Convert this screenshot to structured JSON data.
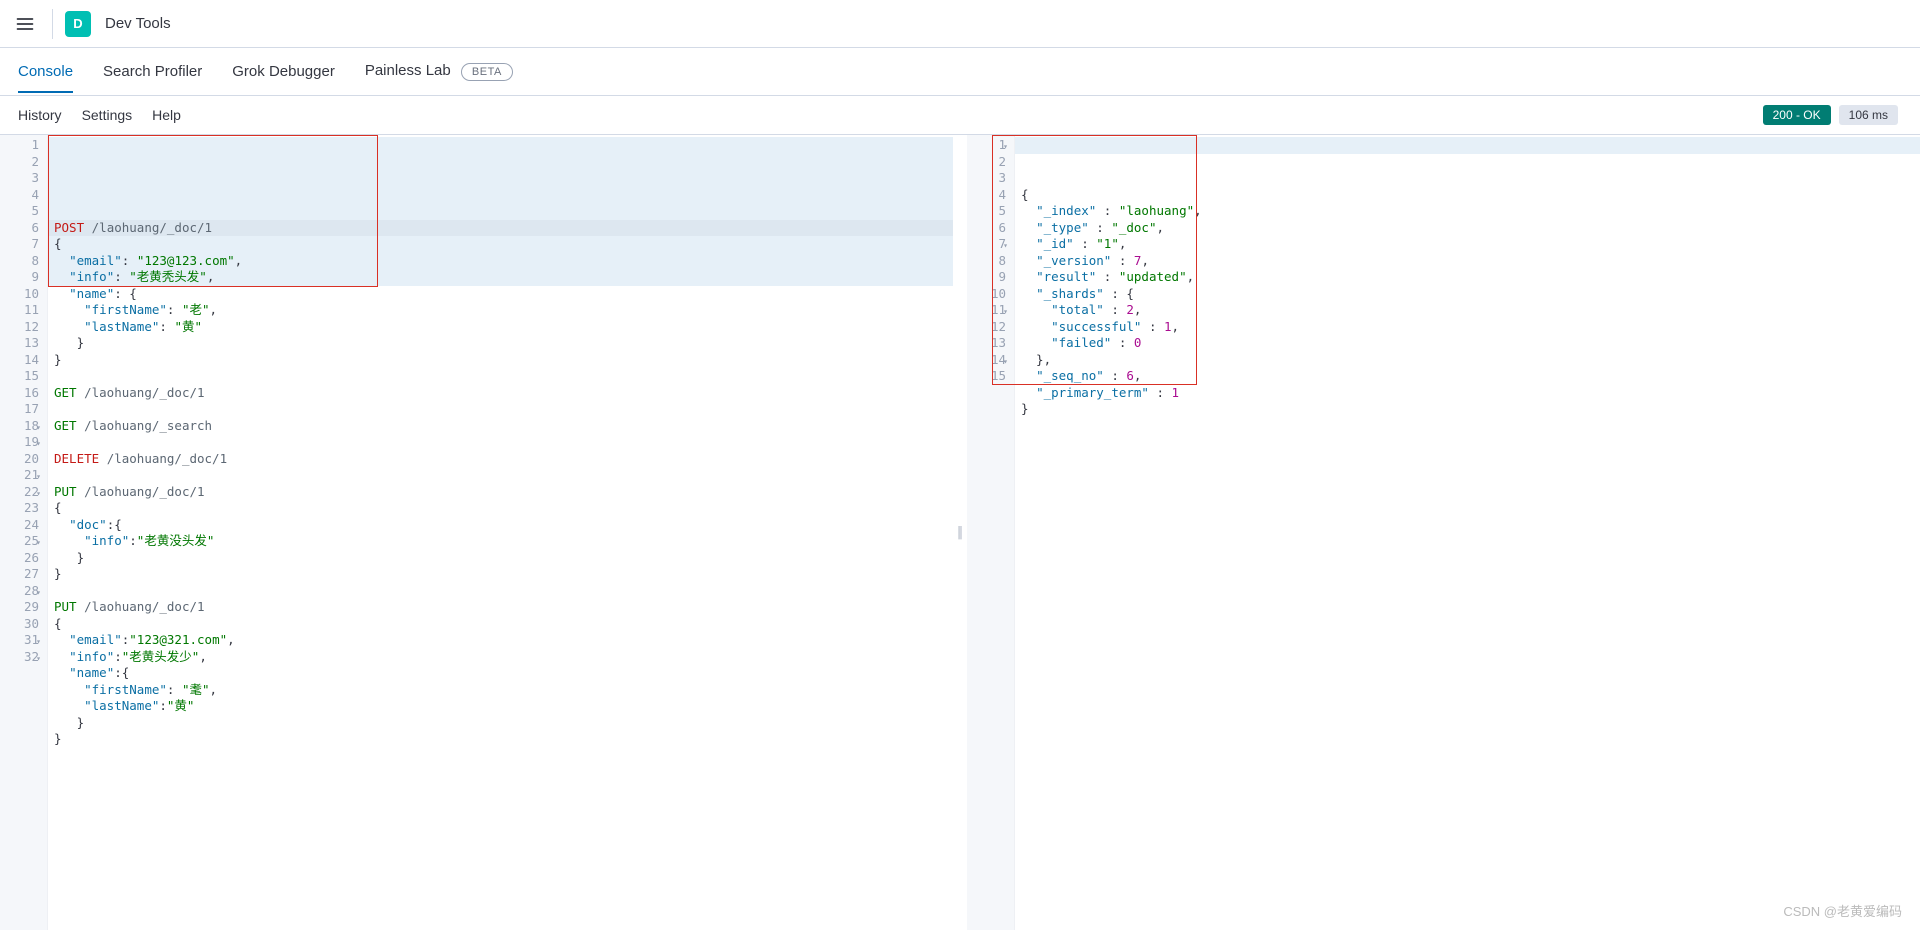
{
  "header": {
    "logo_letter": "D",
    "breadcrumb": "Dev Tools"
  },
  "tabs": {
    "console": "Console",
    "search_profiler": "Search Profiler",
    "grok": "Grok Debugger",
    "painless": "Painless Lab",
    "beta": "BETA"
  },
  "subnav": {
    "history": "History",
    "settings": "Settings",
    "help": "Help"
  },
  "status": {
    "ok": "200 - OK",
    "time": "106 ms"
  },
  "editor_left_lines": [
    {
      "n": "1",
      "method": "POST",
      "url": "/laohuang/_doc/1"
    },
    {
      "n": "2",
      "raw": "{"
    },
    {
      "n": "3",
      "kv": true,
      "ind": "  ",
      "key": "\"email\"",
      "sep": ": ",
      "val": "\"123@123.com\"",
      "tail": ","
    },
    {
      "n": "4",
      "kv": true,
      "ind": "  ",
      "key": "\"info\"",
      "sep": ": ",
      "val": "\"老黄秃头发\"",
      "tail": ","
    },
    {
      "n": "5",
      "kv": true,
      "ind": "  ",
      "key": "\"name\"",
      "sep": ": ",
      "open": "{"
    },
    {
      "n": "6",
      "kv": true,
      "ind": "    ",
      "key": "\"firstName\"",
      "sep": ": ",
      "val": "\"老\"",
      "tail": ","
    },
    {
      "n": "7",
      "kv": true,
      "ind": "    ",
      "key": "\"lastName\"",
      "sep": ": ",
      "val": "\"黄\""
    },
    {
      "n": "8",
      "raw": "   }"
    },
    {
      "n": "9",
      "raw": "}"
    },
    {
      "n": "10",
      "raw": ""
    },
    {
      "n": "11",
      "method": "GET",
      "url": "/laohuang/_doc/1"
    },
    {
      "n": "12",
      "raw": ""
    },
    {
      "n": "13",
      "method": "GET",
      "url": "/laohuang/_search"
    },
    {
      "n": "14",
      "raw": ""
    },
    {
      "n": "15",
      "method": "DELETE",
      "url": "/laohuang/_doc/1"
    },
    {
      "n": "16",
      "raw": ""
    },
    {
      "n": "17",
      "method": "PUT",
      "url": "/laohuang/_doc/1"
    },
    {
      "n": "18",
      "raw": "{",
      "fold": true
    },
    {
      "n": "19",
      "kv": true,
      "ind": "  ",
      "key": "\"doc\"",
      "sep": ":",
      "open": "{",
      "fold": true
    },
    {
      "n": "20",
      "kv": true,
      "ind": "    ",
      "key": "\"info\"",
      "sep": ":",
      "val": "\"老黄没头发\""
    },
    {
      "n": "21",
      "raw": "   }",
      "fold": true
    },
    {
      "n": "22",
      "raw": "}",
      "fold": true
    },
    {
      "n": "23",
      "raw": ""
    },
    {
      "n": "24",
      "method": "PUT",
      "url": "/laohuang/_doc/1"
    },
    {
      "n": "25",
      "raw": "{",
      "fold": true
    },
    {
      "n": "26",
      "kv": true,
      "ind": "  ",
      "key": "\"email\"",
      "sep": ":",
      "val": "\"123@321.com\"",
      "tail": ","
    },
    {
      "n": "27",
      "kv": true,
      "ind": "  ",
      "key": "\"info\"",
      "sep": ":",
      "val": "\"老黄头发少\"",
      "tail": ","
    },
    {
      "n": "28",
      "kv": true,
      "ind": "  ",
      "key": "\"name\"",
      "sep": ":",
      "open": "{",
      "fold": true
    },
    {
      "n": "29",
      "kv": true,
      "ind": "    ",
      "key": "\"firstName\"",
      "sep": ": ",
      "val": "\"耄\"",
      "tail": ","
    },
    {
      "n": "30",
      "kv": true,
      "ind": "    ",
      "key": "\"lastName\"",
      "sep": ":",
      "val": "\"黄\""
    },
    {
      "n": "31",
      "raw": "   }",
      "fold": true
    },
    {
      "n": "32",
      "raw": "}",
      "fold": true
    }
  ],
  "editor_right_lines": [
    {
      "n": "1",
      "raw": "{",
      "fold": true
    },
    {
      "n": "2",
      "kv": true,
      "ind": "  ",
      "key": "\"_index\"",
      "sep": " : ",
      "val": "\"laohuang\"",
      "tail": ","
    },
    {
      "n": "3",
      "kv": true,
      "ind": "  ",
      "key": "\"_type\"",
      "sep": " : ",
      "val": "\"_doc\"",
      "tail": ","
    },
    {
      "n": "4",
      "kv": true,
      "ind": "  ",
      "key": "\"_id\"",
      "sep": " : ",
      "val": "\"1\"",
      "tail": ","
    },
    {
      "n": "5",
      "kv": true,
      "ind": "  ",
      "key": "\"_version\"",
      "sep": " : ",
      "num": "7",
      "tail": ","
    },
    {
      "n": "6",
      "kv": true,
      "ind": "  ",
      "key": "\"result\"",
      "sep": " : ",
      "val": "\"updated\"",
      "tail": ","
    },
    {
      "n": "7",
      "kv": true,
      "ind": "  ",
      "key": "\"_shards\"",
      "sep": " : ",
      "open": "{",
      "fold": true
    },
    {
      "n": "8",
      "kv": true,
      "ind": "    ",
      "key": "\"total\"",
      "sep": " : ",
      "num": "2",
      "tail": ","
    },
    {
      "n": "9",
      "kv": true,
      "ind": "    ",
      "key": "\"successful\"",
      "sep": " : ",
      "num": "1",
      "tail": ","
    },
    {
      "n": "10",
      "kv": true,
      "ind": "    ",
      "key": "\"failed\"",
      "sep": " : ",
      "num": "0"
    },
    {
      "n": "11",
      "raw": "  },",
      "fold": true
    },
    {
      "n": "12",
      "kv": true,
      "ind": "  ",
      "key": "\"_seq_no\"",
      "sep": " : ",
      "num": "6",
      "tail": ","
    },
    {
      "n": "13",
      "kv": true,
      "ind": "  ",
      "key": "\"_primary_term\"",
      "sep": " : ",
      "num": "1"
    },
    {
      "n": "14",
      "raw": "}",
      "fold": true
    },
    {
      "n": "15",
      "raw": ""
    }
  ],
  "watermark": "CSDN @老黄爱编码"
}
